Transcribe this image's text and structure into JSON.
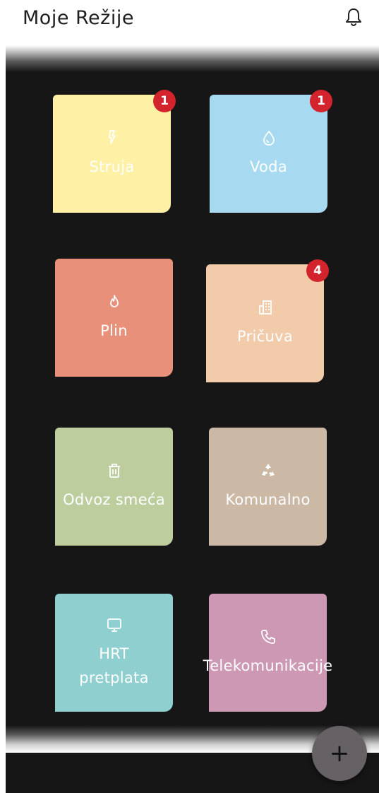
{
  "app": {
    "title": "Moje Režije"
  },
  "header": {
    "notifications_icon": "bell-icon"
  },
  "tiles": [
    {
      "label": "Struja",
      "icon": "lightning-icon",
      "color": "#fef0a5",
      "badge": "1"
    },
    {
      "label": "Voda",
      "icon": "water-drop-icon",
      "color": "#a7daf0",
      "badge": "1"
    },
    {
      "label": "Plin",
      "icon": "flame-icon",
      "color": "#e8907a",
      "badge": ""
    },
    {
      "label": "Pričuva",
      "icon": "building-icon",
      "color": "#f2cbab",
      "badge": "4"
    },
    {
      "label": "Odvoz smeća",
      "icon": "trash-icon",
      "color": "#bdcd9e",
      "badge": ""
    },
    {
      "label": "Komunalno",
      "icon": "recycle-icon",
      "color": "#cbb9a6",
      "badge": ""
    },
    {
      "label": "HRT pretplata",
      "icon": "monitor-icon",
      "color": "#8fcfcf",
      "badge": ""
    },
    {
      "label": "Telekomunikacije",
      "icon": "phone-icon",
      "color": "#cd98b3",
      "badge": ""
    }
  ],
  "fab": {
    "label": "+",
    "icon": "plus-icon"
  }
}
